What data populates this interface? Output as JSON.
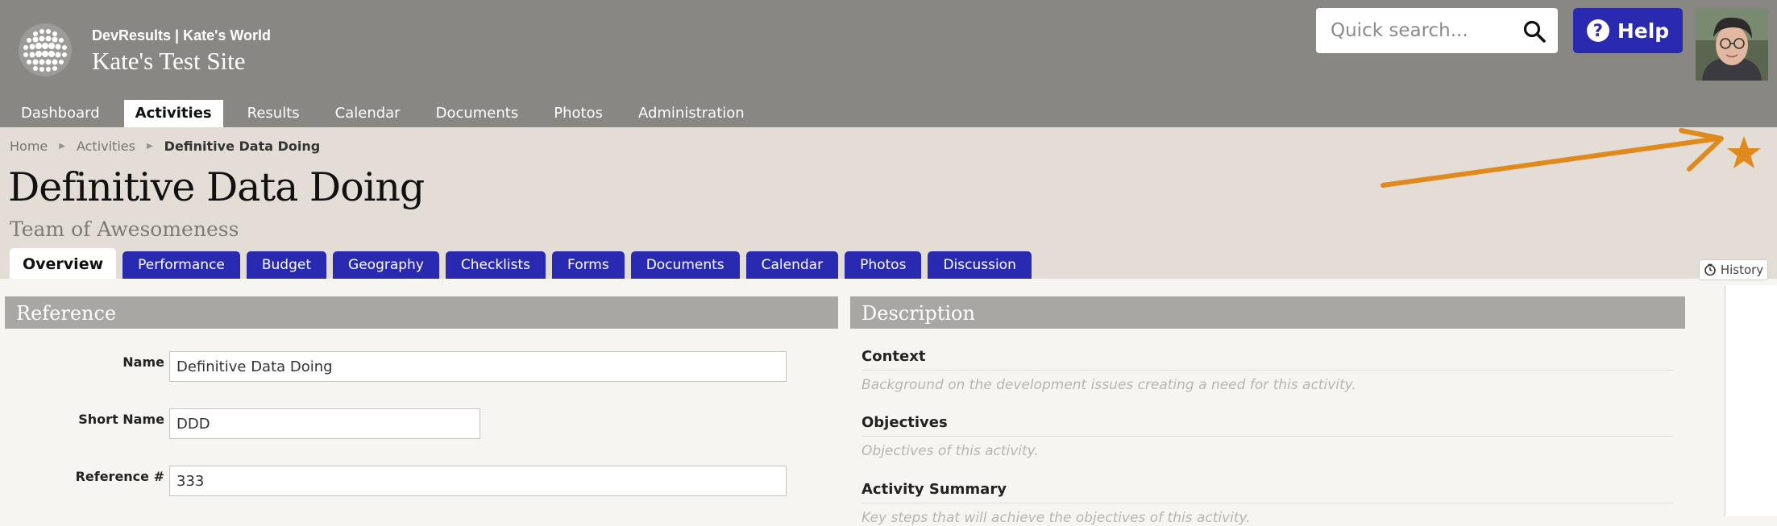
{
  "header": {
    "org_line": "DevResults | Kate's World",
    "site_name": "Kate's Test Site",
    "search": {
      "placeholder": "Quick search...",
      "value": ""
    },
    "help_label": "Help"
  },
  "main_nav": [
    "Dashboard",
    "Activities",
    "Results",
    "Calendar",
    "Documents",
    "Photos",
    "Administration"
  ],
  "main_nav_active": "Activities",
  "breadcrumb": {
    "home": "Home",
    "section": "Activities",
    "current": "Definitive Data Doing"
  },
  "page": {
    "title": "Definitive Data Doing",
    "subtitle": "Team of Awesomeness"
  },
  "tabs": [
    "Overview",
    "Performance",
    "Budget",
    "Geography",
    "Checklists",
    "Forms",
    "Documents",
    "Calendar",
    "Photos",
    "Discussion"
  ],
  "tabs_active": "Overview",
  "history_label": "History",
  "reference": {
    "heading": "Reference",
    "name_label": "Name",
    "name_value": "Definitive Data Doing",
    "short_name_label": "Short Name",
    "short_name_value": "DDD",
    "ref_label": "Reference #",
    "ref_value": "333"
  },
  "description": {
    "heading": "Description",
    "context_heading": "Context",
    "context_placeholder": "Background on the development issues creating a need for this activity.",
    "objectives_heading": "Objectives",
    "objectives_placeholder": "Objectives of this activity.",
    "summary_heading": "Activity Summary",
    "summary_placeholder": "Key steps that will achieve the objectives of this activity."
  },
  "colors": {
    "header_bg": "#888784",
    "page_head_bg": "#e4ddd6",
    "tab_blue": "#2a2ab0",
    "annotation_orange": "#e0891d",
    "panel_header_bg": "#a8a7a3"
  },
  "icons": {
    "logo": "dot-globe-icon",
    "search": "search-icon",
    "help": "question-circle-icon",
    "favorite": "star-icon",
    "history": "history-clock-icon"
  }
}
